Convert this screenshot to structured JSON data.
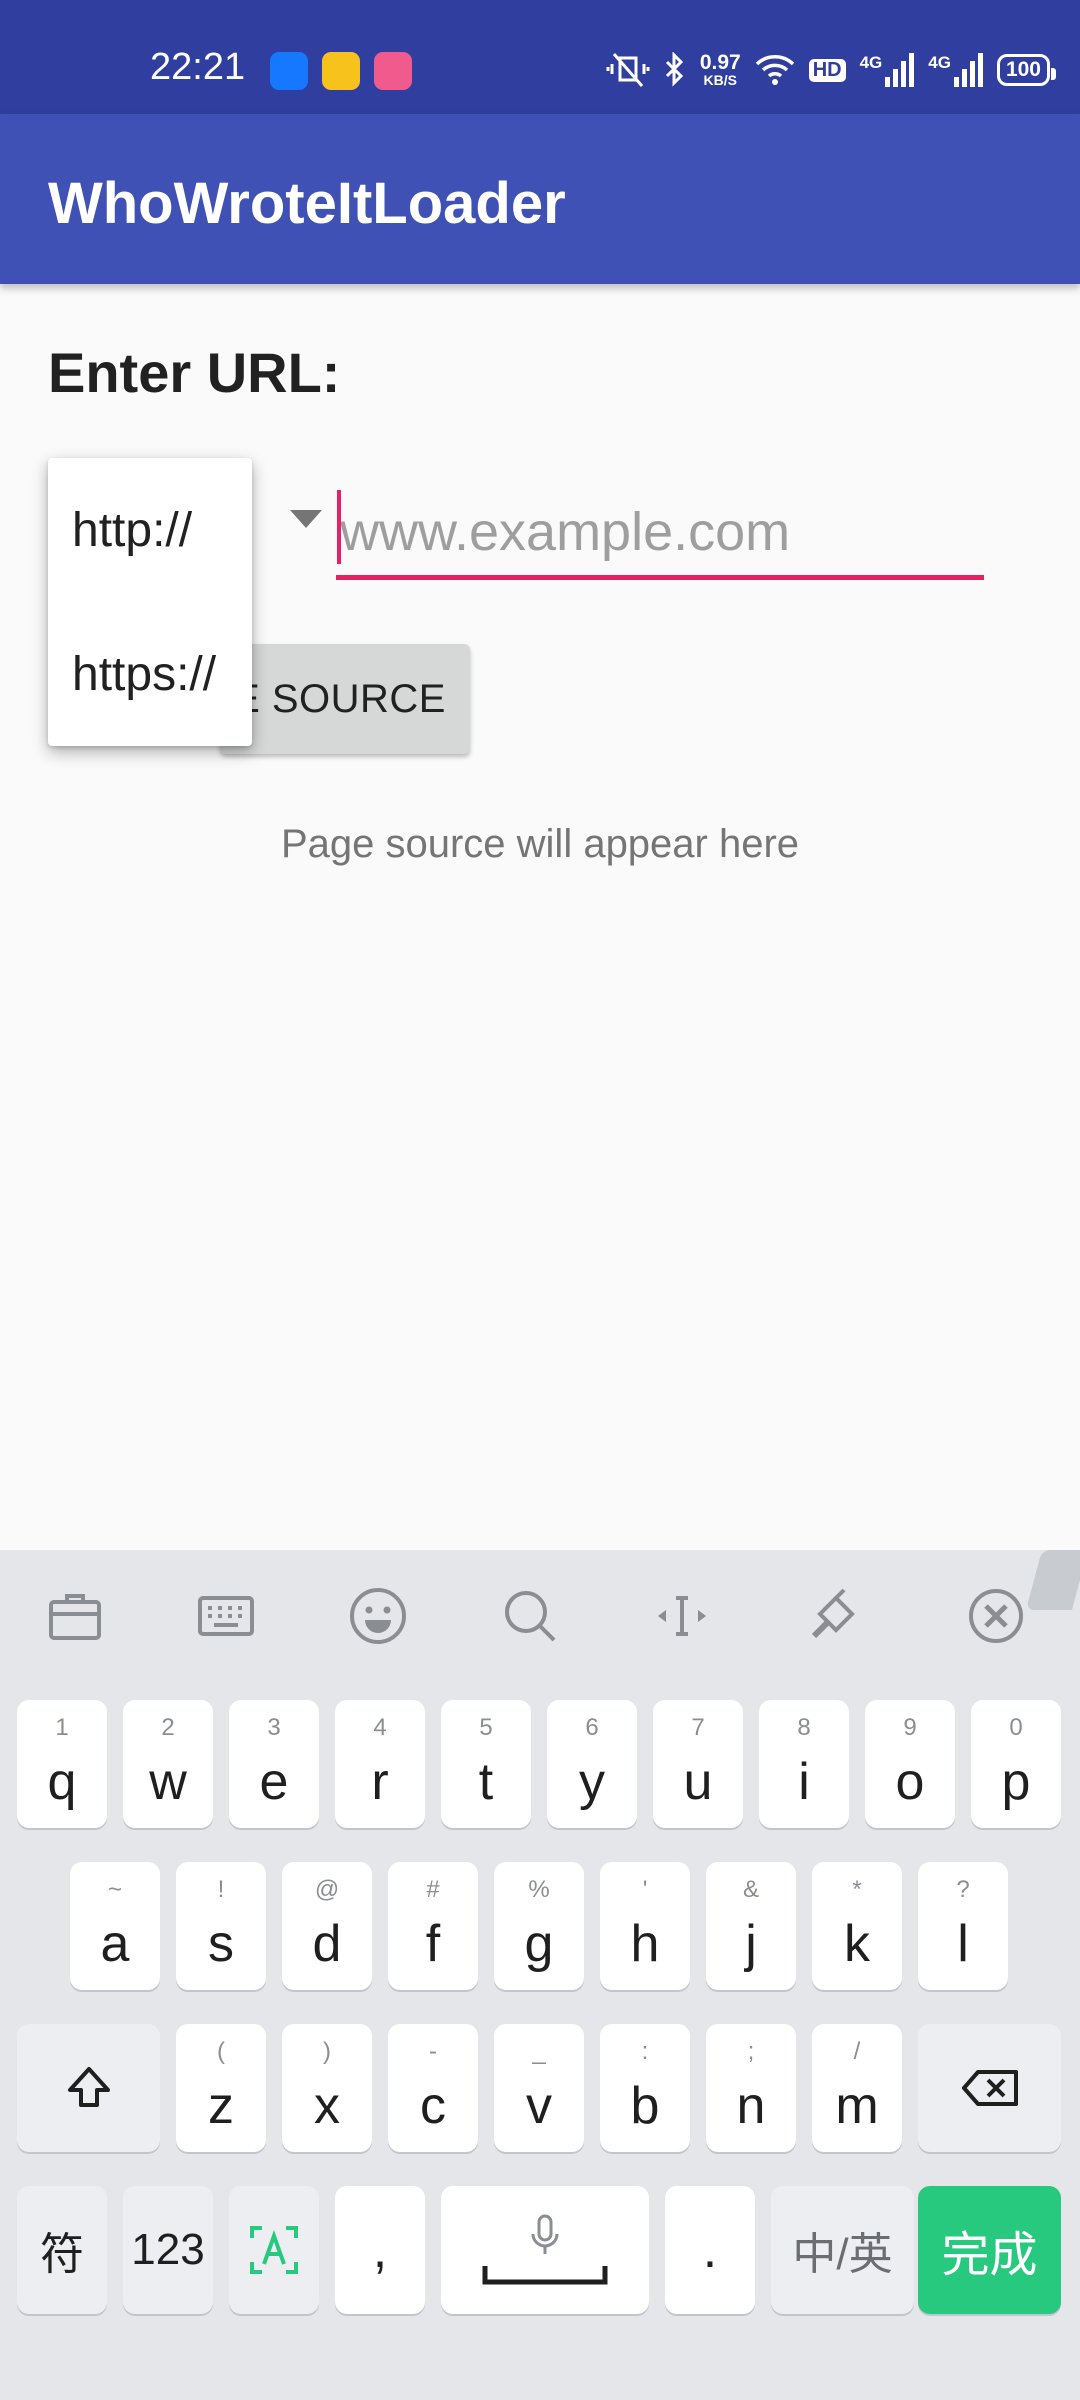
{
  "status_bar": {
    "time": "22:21",
    "app_icons": [
      {
        "name": "alipay-app-icon",
        "color": "#1677ff"
      },
      {
        "name": "notes-app-icon",
        "color": "#f7c21b"
      },
      {
        "name": "ticket-app-icon",
        "color": "#f05a8c"
      }
    ],
    "net_speed": "0.97",
    "net_unit": "KB/S",
    "hd_label": "HD",
    "sig1_label": "4G",
    "sig2_label": "4G",
    "battery": "100"
  },
  "app_bar": {
    "title": "WhoWroteItLoader"
  },
  "form": {
    "label": "Enter URL:",
    "url_placeholder": "www.example.com",
    "get_button_label": "E SOURCE",
    "protocol_options": [
      "http://",
      "https://"
    ],
    "result_text": "Page source will appear here"
  },
  "keyboard": {
    "toolbar_icons": [
      "toolbox-icon",
      "keyboard-icon",
      "emoji-icon",
      "search-icon",
      "cursor-move-icon",
      "skin-brush-icon",
      "collapse-close-icon"
    ],
    "row1": [
      {
        "main": "q",
        "sub": "1"
      },
      {
        "main": "w",
        "sub": "2"
      },
      {
        "main": "e",
        "sub": "3"
      },
      {
        "main": "r",
        "sub": "4"
      },
      {
        "main": "t",
        "sub": "5"
      },
      {
        "main": "y",
        "sub": "6"
      },
      {
        "main": "u",
        "sub": "7"
      },
      {
        "main": "i",
        "sub": "8"
      },
      {
        "main": "o",
        "sub": "9"
      },
      {
        "main": "p",
        "sub": "0"
      }
    ],
    "row2": [
      {
        "main": "a",
        "sub": "~"
      },
      {
        "main": "s",
        "sub": "!"
      },
      {
        "main": "d",
        "sub": "@"
      },
      {
        "main": "f",
        "sub": "#"
      },
      {
        "main": "g",
        "sub": "%"
      },
      {
        "main": "h",
        "sub": "'"
      },
      {
        "main": "j",
        "sub": "&"
      },
      {
        "main": "k",
        "sub": "*"
      },
      {
        "main": "l",
        "sub": "?"
      }
    ],
    "row3": [
      {
        "main": "z",
        "sub": "("
      },
      {
        "main": "x",
        "sub": ")"
      },
      {
        "main": "c",
        "sub": "-"
      },
      {
        "main": "v",
        "sub": "_"
      },
      {
        "main": "b",
        "sub": ":"
      },
      {
        "main": "n",
        "sub": ";"
      },
      {
        "main": "m",
        "sub": "/"
      }
    ],
    "bottom": {
      "symbols": "符",
      "numbers": "123",
      "comma": ",",
      "period": ".",
      "lang": "中/英",
      "done": "完成"
    }
  }
}
